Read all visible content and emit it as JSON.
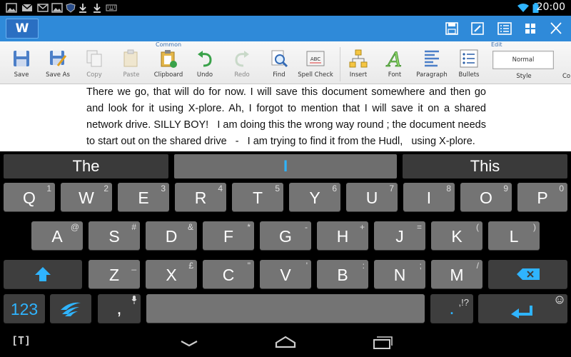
{
  "status_bar": {
    "time": "20:00",
    "left_icons": [
      "gallery-icon",
      "gmail-icon",
      "email-icon",
      "gallery-icon",
      "shield-icon",
      "download-icon",
      "download-icon",
      "keyboard-icon"
    ],
    "right_icons": [
      "wifi-icon",
      "battery-icon"
    ]
  },
  "title_bar": {
    "logo_letter": "W",
    "buttons": [
      "save-icon",
      "edit-icon",
      "list-view-icon",
      "grid-view-icon",
      "close-icon"
    ],
    "color": "#2f8ad9"
  },
  "ribbon": {
    "groups": [
      {
        "label": "Common"
      },
      {
        "label": "Edit"
      }
    ],
    "buttons": [
      {
        "label": "Save",
        "icon": "save-icon",
        "enabled": true
      },
      {
        "label": "Save As",
        "icon": "save-as-icon",
        "enabled": true
      },
      {
        "label": "Copy",
        "icon": "copy-icon",
        "enabled": false
      },
      {
        "label": "Paste",
        "icon": "paste-icon",
        "enabled": false
      },
      {
        "label": "Clipboard",
        "icon": "clipboard-icon",
        "enabled": true
      },
      {
        "label": "Undo",
        "icon": "undo-icon",
        "enabled": true
      },
      {
        "label": "Redo",
        "icon": "redo-icon",
        "enabled": false
      },
      {
        "label": "Find",
        "icon": "find-icon",
        "enabled": true
      },
      {
        "label": "Spell Check",
        "icon": "spell-check-icon",
        "enabled": true
      },
      {
        "label": "Insert",
        "icon": "insert-icon",
        "enabled": true
      },
      {
        "label": "Font",
        "icon": "font-icon",
        "enabled": true
      },
      {
        "label": "Paragraph",
        "icon": "paragraph-icon",
        "enabled": true
      },
      {
        "label": "Bullets",
        "icon": "bullets-icon",
        "enabled": true
      }
    ],
    "style_value": "Normal",
    "style_label": "Style",
    "truncated_label": "Co"
  },
  "document": {
    "text": "There we go, that will do for now. I will save this document somewhere and then go and look for it using X-plore. Ah, I forgot to mention that I will save it on a shared network drive. SILLY BOY!   I am doing this the wrong way round ; the document needs to start out on the shared drive   -   I am trying to find it from the Hudl,   using X-plore."
  },
  "keyboard": {
    "suggestions": [
      "The",
      "I",
      "This"
    ],
    "row1": [
      {
        "key": "Q",
        "alt": "1"
      },
      {
        "key": "W",
        "alt": "2"
      },
      {
        "key": "E",
        "alt": "3"
      },
      {
        "key": "R",
        "alt": "4"
      },
      {
        "key": "T",
        "alt": "5"
      },
      {
        "key": "Y",
        "alt": "6"
      },
      {
        "key": "U",
        "alt": "7"
      },
      {
        "key": "I",
        "alt": "8"
      },
      {
        "key": "O",
        "alt": "9"
      },
      {
        "key": "P",
        "alt": "0"
      }
    ],
    "row2": [
      {
        "key": "A",
        "alt": "@"
      },
      {
        "key": "S",
        "alt": "#"
      },
      {
        "key": "D",
        "alt": "&"
      },
      {
        "key": "F",
        "alt": "*"
      },
      {
        "key": "G",
        "alt": "-"
      },
      {
        "key": "H",
        "alt": "+"
      },
      {
        "key": "J",
        "alt": "="
      },
      {
        "key": "K",
        "alt": "("
      },
      {
        "key": "L",
        "alt": ")"
      }
    ],
    "row3": [
      {
        "key": "Z",
        "alt": "_"
      },
      {
        "key": "X",
        "alt": "£"
      },
      {
        "key": "C",
        "alt": "\""
      },
      {
        "key": "V",
        "alt": "'"
      },
      {
        "key": "B",
        "alt": ":"
      },
      {
        "key": "N",
        "alt": ";"
      },
      {
        "key": "M",
        "alt": "/"
      }
    ],
    "numbers_label": "123",
    "comma_label": ",",
    "period_label": ".",
    "punct_alt": ",!?",
    "accent_color": "#2fb4ff"
  },
  "nav_bar": {
    "keyboard_switch": "[T]",
    "buttons": [
      "back-icon",
      "home-icon",
      "recent-apps-icon"
    ]
  }
}
